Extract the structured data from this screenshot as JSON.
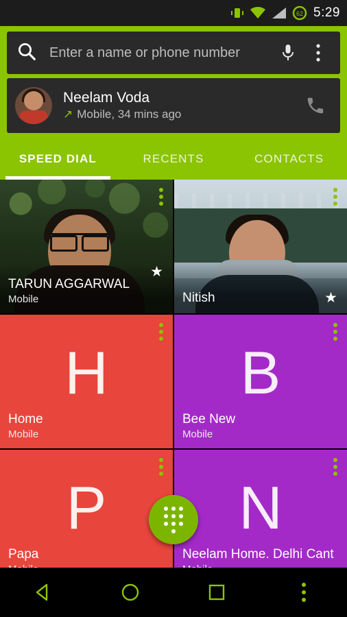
{
  "statusbar": {
    "icons": [
      "vibrate-icon",
      "wifi-icon",
      "signal-icon",
      "battery-icon"
    ],
    "battery_level": "62",
    "time": "5:29"
  },
  "search": {
    "placeholder": "Enter a name or phone number",
    "value": "",
    "search_icon": "search-icon",
    "voice_icon": "microphone-icon",
    "overflow_icon": "overflow-menu-icon"
  },
  "recent_call": {
    "name": "Neelam Voda",
    "direction_icon": "outgoing-call-arrow",
    "detail": "Mobile, 34 mins ago",
    "call_icon": "phone-icon"
  },
  "tabs": [
    {
      "label": "SPEED DIAL",
      "active": true
    },
    {
      "label": "RECENTS",
      "active": false
    },
    {
      "label": "CONTACTS",
      "active": false
    }
  ],
  "speed_dial": [
    {
      "name": "TARUN AGGARWAL",
      "subtitle": "Mobile",
      "type": "photo",
      "photo": "man-with-glasses-in-garden",
      "starred": true,
      "color": ""
    },
    {
      "name": "Nitish",
      "subtitle": "",
      "type": "photo",
      "photo": "man-in-scarf-by-canal-houses",
      "starred": true,
      "color": ""
    },
    {
      "name": "Home",
      "subtitle": "Mobile",
      "type": "letter",
      "letter": "H",
      "starred": false,
      "color": "#E8453C"
    },
    {
      "name": "Bee New",
      "subtitle": "Mobile",
      "type": "letter",
      "letter": "B",
      "starred": false,
      "color": "#A42AC8"
    },
    {
      "name": "Papa",
      "subtitle": "Mobile",
      "type": "letter",
      "letter": "P",
      "starred": false,
      "color": "#E8453C"
    },
    {
      "name": "Neelam Home. Delhi Cant",
      "subtitle": "Mobile",
      "type": "letter",
      "letter": "N",
      "starred": false,
      "color": "#A42AC8"
    }
  ],
  "fab": {
    "icon": "dialpad-icon",
    "color": "#7CB500"
  },
  "navbar": {
    "back_icon": "back-triangle-icon",
    "home_icon": "home-circle-icon",
    "recents_icon": "recents-square-icon",
    "menu_icon": "overflow-menu-icon"
  },
  "theme": {
    "accent": "#8BC400",
    "bar_dark": "#2a2a2a",
    "status_dark": "#1c1c1c"
  }
}
